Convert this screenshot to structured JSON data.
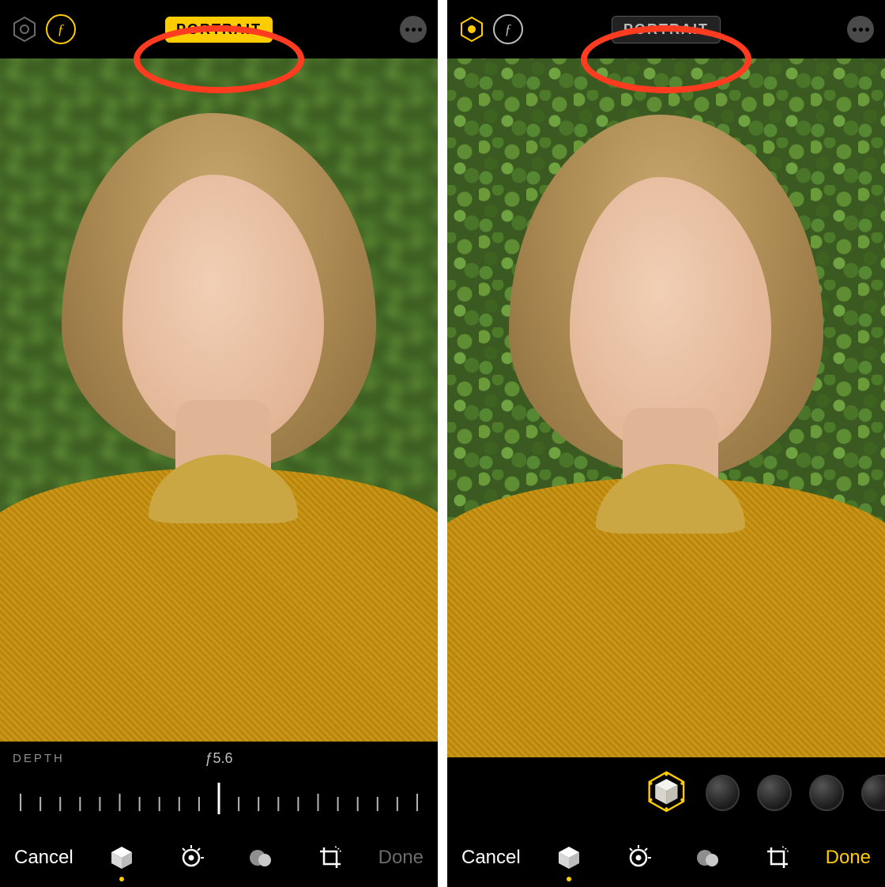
{
  "colors": {
    "accent": "#ffcc00",
    "annotation": "#ff3b20"
  },
  "left": {
    "header": {
      "hex_active": false,
      "f_active": true,
      "mode_label": "PORTRAIT",
      "mode_active": true,
      "more_icon": "ellipsis"
    },
    "depth": {
      "label": "DEPTH",
      "value": "ƒ5.6"
    },
    "bottom": {
      "cancel": "Cancel",
      "done": "Done",
      "done_enabled": false,
      "active_tool": 0,
      "tools": [
        "portrait-cube-icon",
        "adjust-dial-icon",
        "filters-icon",
        "crop-rotate-icon"
      ]
    }
  },
  "right": {
    "header": {
      "hex_active": true,
      "f_active": false,
      "mode_label": "PORTRAIT",
      "mode_active": false,
      "more_icon": "ellipsis"
    },
    "lighting": {
      "selected": 0,
      "options": [
        "natural-light",
        "studio-light",
        "contour-light",
        "stage-light",
        "stage-mono"
      ]
    },
    "bottom": {
      "cancel": "Cancel",
      "done": "Done",
      "done_enabled": true,
      "active_tool": 0,
      "tools": [
        "portrait-cube-icon",
        "adjust-dial-icon",
        "filters-icon",
        "crop-rotate-icon"
      ]
    }
  }
}
